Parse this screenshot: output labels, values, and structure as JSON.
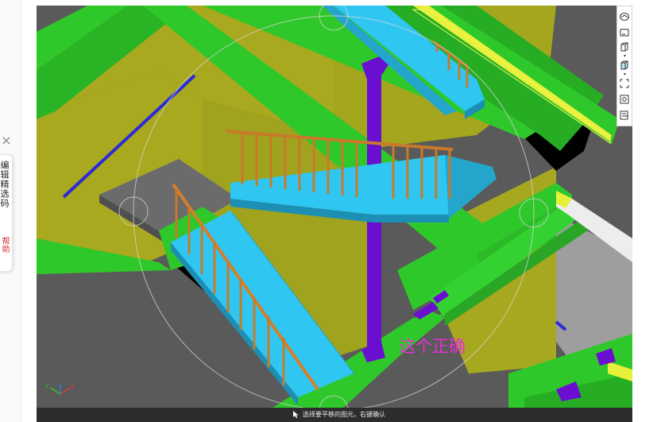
{
  "side_panel": {
    "close_glyph": "×",
    "text": "编辑精选码",
    "red_text": "帮助"
  },
  "viewport": {
    "annotation": "这个正确",
    "status": "选择要平移的图元，右键确认"
  },
  "toolbar": {
    "buttons": [
      "view-cube-icon",
      "wireframe-icon",
      "box-view-icon",
      "shaded-box-icon",
      "fit-view-icon",
      "settings-gear-icon",
      "layers-icon"
    ]
  },
  "colors": {
    "background": "#5a5a5a",
    "beam_green": "#2fc82a",
    "wall_yellow": "#a8a91f",
    "stair_cyan": "#2fc6f2",
    "railing_orange": "#c87a2a",
    "column_purple": "#6a0fd0",
    "annotation_magenta": "#ea2fd8"
  }
}
